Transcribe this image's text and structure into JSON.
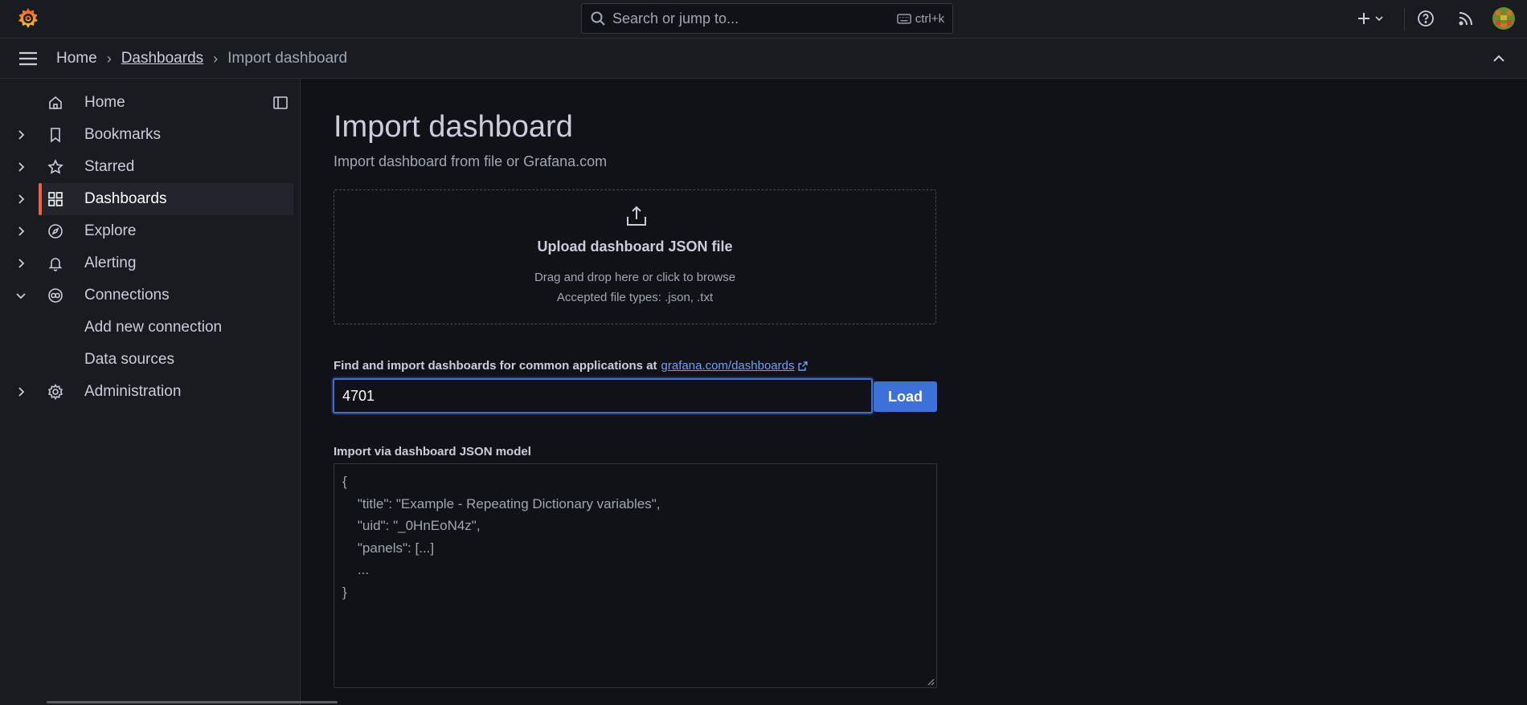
{
  "topbar": {
    "search_placeholder": "Search or jump to...",
    "search_shortcut": "ctrl+k"
  },
  "breadcrumb": {
    "home": "Home",
    "dashboards": "Dashboards",
    "current": "Import dashboard"
  },
  "sidebar": {
    "items": [
      {
        "label": "Home",
        "icon": "home-icon"
      },
      {
        "label": "Bookmarks",
        "icon": "bookmark-icon"
      },
      {
        "label": "Starred",
        "icon": "star-icon"
      },
      {
        "label": "Dashboards",
        "icon": "apps-icon",
        "active": true
      },
      {
        "label": "Explore",
        "icon": "compass-icon"
      },
      {
        "label": "Alerting",
        "icon": "bell-icon"
      },
      {
        "label": "Connections",
        "icon": "connections-icon",
        "expanded": true
      },
      {
        "label": "Administration",
        "icon": "cog-icon"
      }
    ],
    "connections_children": [
      "Add new connection",
      "Data sources"
    ]
  },
  "main": {
    "title": "Import dashboard",
    "subtitle": "Import dashboard from file or Grafana.com",
    "upload": {
      "title": "Upload dashboard JSON file",
      "hint": "Drag and drop here or click to browse",
      "accepted": "Accepted file types: .json, .txt"
    },
    "find": {
      "label": "Find and import dashboards for common applications at",
      "link": "grafana.com/dashboards",
      "input_value": "4701",
      "load_label": "Load"
    },
    "json": {
      "label": "Import via dashboard JSON model",
      "placeholder": "{\n    \"title\": \"Example - Repeating Dictionary variables\",\n    \"uid\": \"_0HnEoN4z\",\n    \"panels\": [...]\n    ...\n}"
    }
  },
  "colors": {
    "accent": "#3d71d9",
    "active_bar": "#f55f3e",
    "background": "#111217",
    "panel": "#181b1f"
  }
}
